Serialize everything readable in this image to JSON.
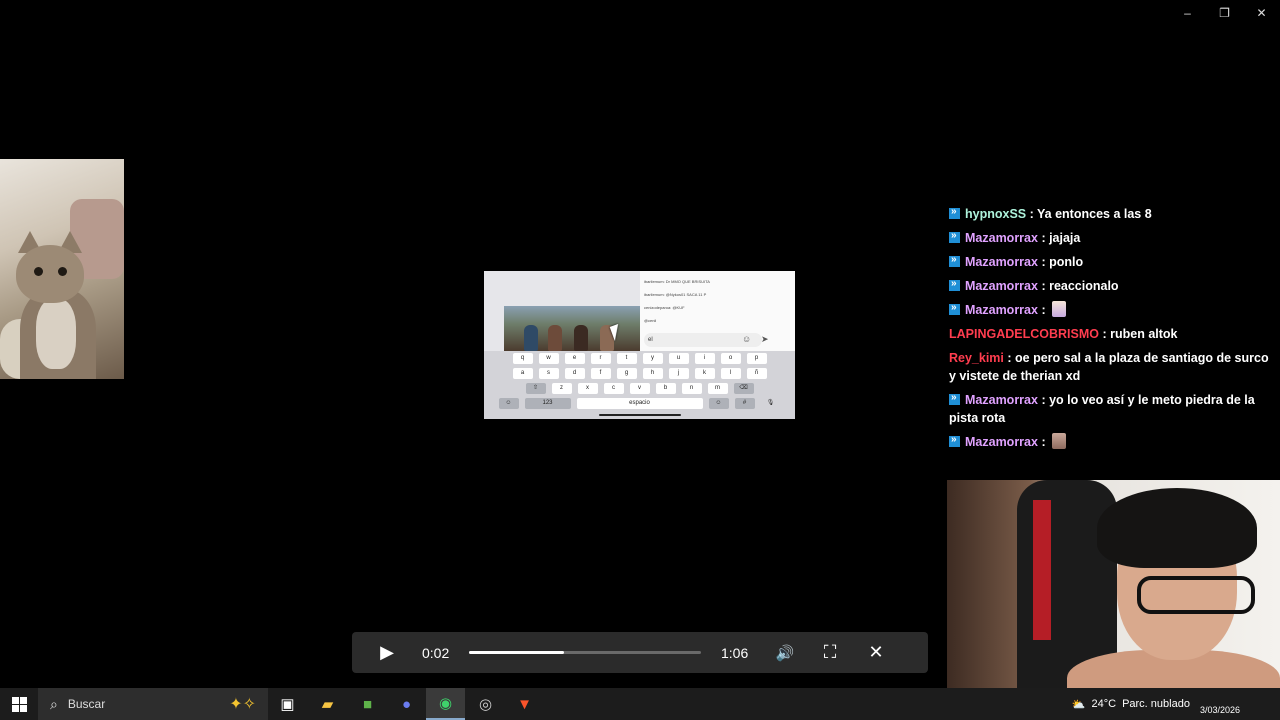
{
  "window": {
    "minimize": "–",
    "restore": "❐",
    "close": "✕"
  },
  "phone": {
    "chat_lines": [
      "ibarilemum: Dr MMO QUE BRISUITA",
      "ibarilemum: @Nykos01 SACA 11 P",
      "cenizodeparoa: @KUF",
      "@cenil"
    ],
    "input_text": "el",
    "keyboard": {
      "row1": [
        "q",
        "w",
        "e",
        "r",
        "t",
        "y",
        "u",
        "i",
        "o",
        "p"
      ],
      "row2": [
        "a",
        "s",
        "d",
        "f",
        "g",
        "h",
        "j",
        "k",
        "l",
        "ñ"
      ],
      "row3": [
        "⇧",
        "z",
        "x",
        "c",
        "v",
        "b",
        "n",
        "m",
        "⌫"
      ],
      "row4_numbers": "123",
      "row4_space": "espacio",
      "row4_hash": "#"
    }
  },
  "chat": [
    {
      "user": "hypnoxSS",
      "text": ": Ya entonces a las 8",
      "badge": true,
      "color": "green"
    },
    {
      "user": "Mazamorrax",
      "text": ": jajaja",
      "badge": true,
      "color": "purple"
    },
    {
      "user": "Mazamorrax",
      "text": ": ponlo",
      "badge": true,
      "color": "purple"
    },
    {
      "user": "Mazamorrax",
      "text": ": reaccionalo",
      "badge": true,
      "color": "purple"
    },
    {
      "user": "Mazamorrax",
      "text": ":",
      "badge": true,
      "color": "purple",
      "emote": true
    },
    {
      "user": "LAPINGADELCOBRISMO",
      "text": ": ruben altok",
      "badge": false,
      "color": "red"
    },
    {
      "user": "Rey_kimi",
      "text": ": oe pero sal a la plaza de santiago de surco y vistete de therian xd",
      "badge": false,
      "color": "red"
    },
    {
      "user": "Mazamorrax",
      "text": ": yo lo veo así y le meto piedra de la pista rota",
      "badge": true,
      "color": "purple"
    },
    {
      "user": "Mazamorrax",
      "text": ":",
      "badge": true,
      "color": "purple",
      "emote": true
    }
  ],
  "player": {
    "current_time": "0:02",
    "duration": "1:06",
    "progress_fraction": 0.41,
    "play_icon": "▶",
    "volume_icon": "🔊",
    "fullscreen_icon": "⛶",
    "close_icon": "✕"
  },
  "taskbar": {
    "search_placeholder": "Buscar",
    "weather_temp": "24°C",
    "weather_text": "Parc. nublado",
    "date": "3/03/2026"
  }
}
